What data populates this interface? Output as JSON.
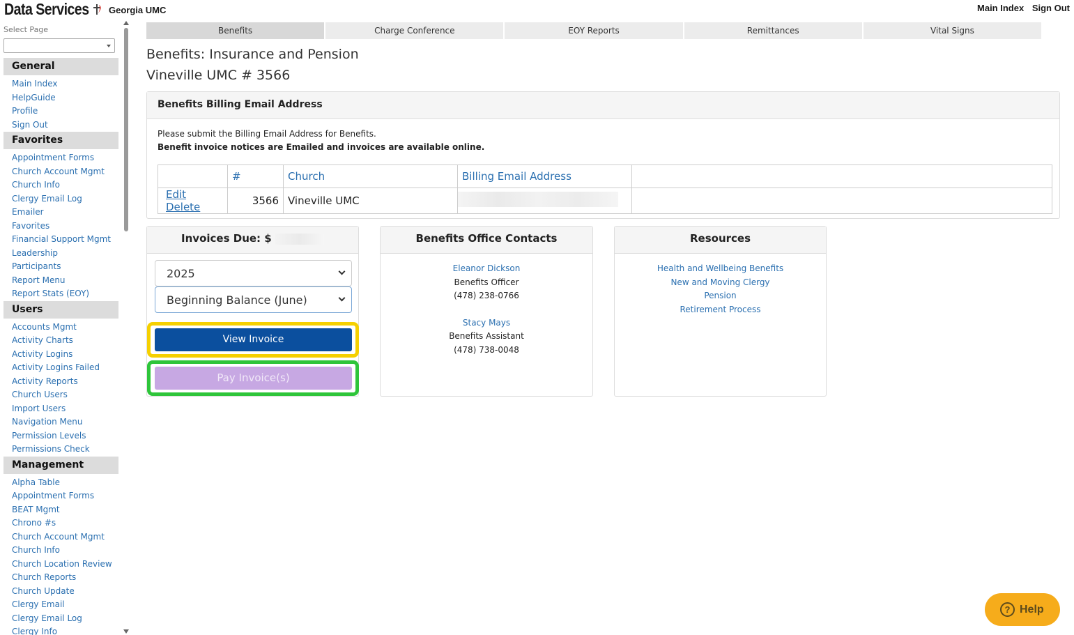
{
  "header": {
    "brand": "Data Services",
    "org": "Georgia UMC",
    "links": [
      "Main Index",
      "Sign Out"
    ]
  },
  "sidebar": {
    "select_label": "Select Page",
    "select_value": "",
    "sections": [
      {
        "title": "General",
        "items": [
          "Main Index",
          "HelpGuide",
          "Profile",
          "Sign Out"
        ]
      },
      {
        "title": "Favorites",
        "items": [
          "Appointment Forms",
          "Church Account Mgmt",
          "Church Info",
          "Clergy Email Log",
          "Emailer",
          "Favorites",
          "Financial Support Mgmt",
          "Leadership",
          "Participants",
          "Report Menu",
          "Report Stats (EOY)"
        ]
      },
      {
        "title": "Users",
        "items": [
          "Accounts Mgmt",
          "Activity Charts",
          "Activity Logins",
          "Activity Logins Failed",
          "Activity Reports",
          "Church Users",
          "Import Users",
          "Navigation Menu",
          "Permission Levels",
          "Permissions Check"
        ]
      },
      {
        "title": "Management",
        "items": [
          "Alpha Table",
          "Appointment Forms",
          "BEAT Mgmt",
          "Chrono #s",
          "Church Account Mgmt",
          "Church Info",
          "Church Location Review",
          "Church Reports",
          "Church Update",
          "Clergy Email",
          "Clergy Email Log",
          "Clergy Info"
        ]
      }
    ]
  },
  "tabs": [
    "Benefits",
    "Charge Conference",
    "EOY Reports",
    "Remittances",
    "Vital Signs"
  ],
  "page": {
    "title": "Benefits: Insurance and Pension",
    "subtitle": "Vineville UMC # 3566"
  },
  "billing": {
    "heading": "Benefits Billing Email Address",
    "line1": "Please submit the Billing Email Address for Benefits.",
    "line2": "Benefit invoice notices are Emailed and invoices are available online.",
    "columns": [
      "",
      "#",
      "Church",
      "Billing Email Address",
      ""
    ],
    "row": {
      "edit": "Edit",
      "delete": "Delete",
      "number": "3566",
      "church": "Vineville UMC",
      "email": ""
    }
  },
  "invoices": {
    "heading": "Invoices Due: $",
    "year": "2025",
    "period": "Beginning Balance (June)",
    "view_label": "View Invoice",
    "pay_label": "Pay Invoice(s)"
  },
  "contacts": {
    "heading": "Benefits Office Contacts",
    "people": [
      {
        "name": "Eleanor Dickson",
        "role": "Benefits Officer",
        "phone": "(478) 238-0766"
      },
      {
        "name": "Stacy Mays",
        "role": "Benefits Assistant",
        "phone": "(478) 738-0048"
      }
    ]
  },
  "resources": {
    "heading": "Resources",
    "links": [
      "Health and Wellbeing Benefits",
      "New and Moving Clergy",
      "Pension",
      "Retirement Process"
    ]
  },
  "help": {
    "label": "Help",
    "icon": "question-circle-icon"
  },
  "colors": {
    "accent": "#0b4f9e",
    "pay": "#c7a8e3",
    "highlight_yellow": "#f5d000",
    "highlight_green": "#2ec53a",
    "help": "#f6ac1b"
  }
}
